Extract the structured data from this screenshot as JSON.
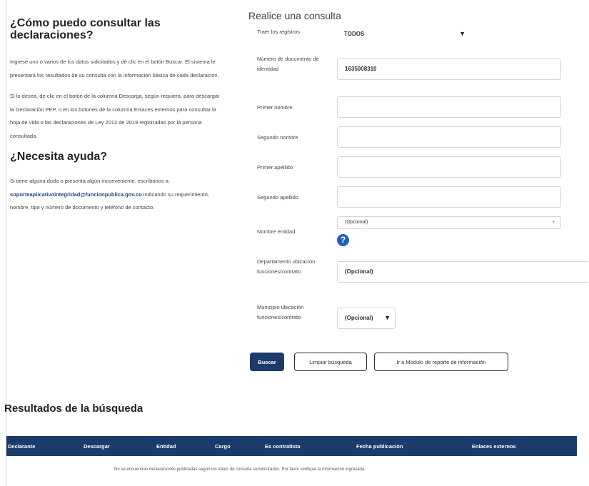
{
  "left": {
    "heading1_line1": "¿Cómo puedo consultar las",
    "heading1_line2": "declaraciones?",
    "para1": "Ingrese uno o varios de los datos solicitados y dé clic en el botón Buscar. El sistema le presentará los resultados de su consulta con la información básica de cada declaración.",
    "para2": "Si lo desea, dé clic en el botón de la columna Descarga, según requiera, para descargar la Declaración PEP, o en los botones de la columna Enlaces externos para consultar la hoja de vida o las declaraciones de Ley 2013 de 2019 registradas por la persona consultada.",
    "heading2": "¿Necesita ayuda?",
    "para3_before": "Si tiene alguna duda o presenta algún inconveniente, escríbanos a:",
    "email": "soporteaplicativointegridad@funcionpublica.gov.co",
    "para3_after": "indicando su requerimiento, nombre, tipo y número de documento y teléfono de contacto."
  },
  "form": {
    "title": "Realice una consulta",
    "traer_label": "Traer los registros",
    "traer_value": "TODOS",
    "doc_label": "Número de documento de identidad",
    "doc_value": "1635008310",
    "primer_nombre_label": "Primer nombre",
    "segundo_nombre_label": "Segundo nombre",
    "primer_apellido_label": "Primer apellido",
    "segundo_apellido_label": "Segundo apellido",
    "entidad_label": "Nombre entidad",
    "entidad_value": "(Opcional)",
    "depto_label": "Departamento ubicación funciones/contrato",
    "depto_value": "(Opcional)",
    "municipio_label": "Municipio ubicación funciones/contrato",
    "municipio_value": "(Opcional)",
    "buscar": "Buscar",
    "limpiar": "Limpiar búsqueda",
    "reporte": "Ir a Módulo de reporte de información"
  },
  "results": {
    "title": "Resultados de la búsqueda",
    "columns": [
      "Declarante",
      "Descargar",
      "Entidad",
      "Cargo",
      "Es contratista",
      "Fecha publicación",
      "Enlaces externos"
    ],
    "empty": "No se encuentran declaraciones publicadas según los datos de consulta suministrados. Por favor verifique la información ingresada."
  }
}
